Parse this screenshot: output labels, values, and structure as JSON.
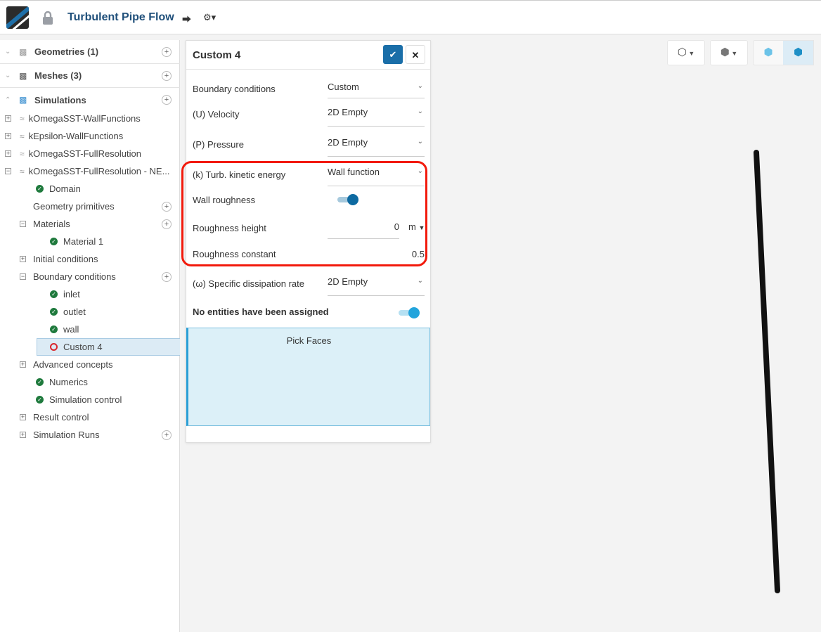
{
  "header": {
    "title": "Turbulent Pipe Flow"
  },
  "sidebar": {
    "sections": [
      {
        "label": "Geometries (1)"
      },
      {
        "label": "Meshes (3)"
      },
      {
        "label": "Simulations"
      }
    ],
    "tree": [
      {
        "label": "kOmegaSST-WallFunctions"
      },
      {
        "label": "kEpsilon-WallFunctions"
      },
      {
        "label": "kOmegaSST-FullResolution"
      },
      {
        "label": "kOmegaSST-FullResolution - NE..."
      },
      {
        "label": "Domain"
      },
      {
        "label": "Geometry primitives"
      },
      {
        "label": "Materials"
      },
      {
        "label": "Material 1"
      },
      {
        "label": "Initial conditions"
      },
      {
        "label": "Boundary conditions"
      },
      {
        "label": "inlet"
      },
      {
        "label": "outlet"
      },
      {
        "label": "wall"
      },
      {
        "label": "Custom 4"
      },
      {
        "label": "Advanced concepts"
      },
      {
        "label": "Numerics"
      },
      {
        "label": "Simulation control"
      },
      {
        "label": "Result control"
      },
      {
        "label": "Simulation Runs"
      }
    ]
  },
  "panel": {
    "title": "Custom 4",
    "fields": {
      "bc": {
        "label": "Boundary conditions",
        "value": "Custom"
      },
      "u": {
        "label": "(U) Velocity",
        "value": "2D Empty"
      },
      "p": {
        "label": "(P) Pressure",
        "value": "2D Empty"
      },
      "k": {
        "label": "(k) Turb. kinetic energy",
        "value": "Wall function"
      },
      "wall_roughness": {
        "label": "Wall roughness",
        "on": true
      },
      "rough_h": {
        "label": "Roughness height",
        "value": "0",
        "unit": "m"
      },
      "rough_c": {
        "label": "Roughness constant",
        "value": "0.5"
      },
      "omega": {
        "label": "(ω) Specific dissipation rate",
        "value": "2D Empty"
      },
      "entities": {
        "label": "No entities have been assigned",
        "on": true
      }
    },
    "pick_faces": "Pick Faces"
  },
  "colors": {
    "accent": "#1a6ea8",
    "highlight": "#f21a0c",
    "success": "#1f7a3d"
  }
}
